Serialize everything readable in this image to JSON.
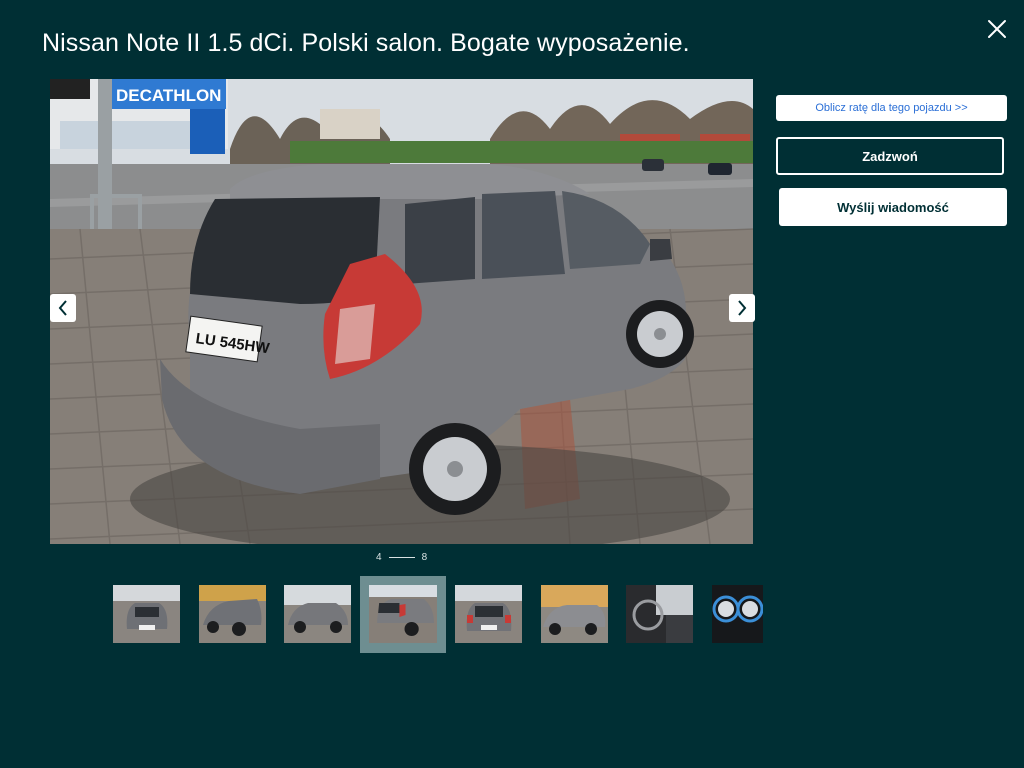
{
  "header": {
    "title": "Nissan Note II 1.5 dCi. Polski salon. Bogate wyposażenie.",
    "close_icon": "close-icon"
  },
  "gallery": {
    "current": "4",
    "total": "8",
    "prev_icon": "chevron-left-icon",
    "next_icon": "chevron-right-icon",
    "plate_text": "LU 545HW",
    "sign_text": "DECATHLON",
    "thumbnails": [
      {
        "id": 1
      },
      {
        "id": 2
      },
      {
        "id": 3
      },
      {
        "id": 4,
        "active": true
      },
      {
        "id": 5
      },
      {
        "id": 6
      },
      {
        "id": 7
      },
      {
        "id": 8
      }
    ]
  },
  "actions": {
    "rate_label": "Oblicz ratę dla tego pojazdu >>",
    "call_label": "Zadzwoń",
    "message_label": "Wyślij wiadomość"
  },
  "colors": {
    "background": "#002f34",
    "link_blue": "#2b6fd6",
    "active_thumb": "#6e8e91"
  }
}
